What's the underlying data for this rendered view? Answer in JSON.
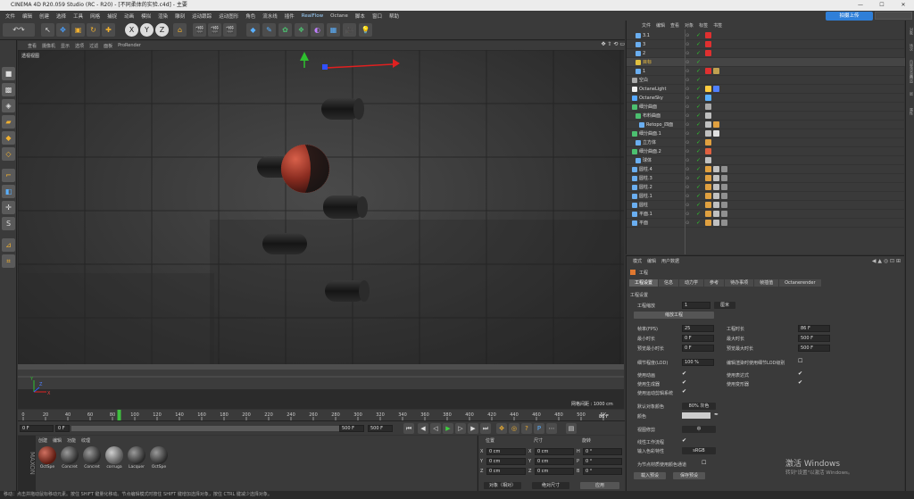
{
  "window": {
    "title": "CINEMA 4D R20.059 Studio (RC - R20) - [不同柔体的实验.c4d] - 主要",
    "controls": [
      "—",
      "☐",
      "✕"
    ]
  },
  "menu": [
    "文件",
    "编辑",
    "创建",
    "选择",
    "工具",
    "网格",
    "捕捉",
    "动画",
    "模拟",
    "渲染",
    "雕刻",
    "运动跟踪",
    "运动图形",
    "角色",
    "流水线",
    "插件",
    "RealFlow",
    "Octane",
    "脚本",
    "窗口",
    "帮助"
  ],
  "upload": {
    "label": "拍摄上传"
  },
  "viewport": {
    "tabs": [
      "查看",
      "摄像机",
      "显示",
      "选项",
      "过滤",
      "面板",
      "ProRender"
    ],
    "label": "透视视图",
    "status": "网格间距 : 1000 cm",
    "axis": {
      "y": "Y",
      "z": "Z",
      "x": "X"
    }
  },
  "timeline": {
    "ticks": [
      "0",
      "20",
      "40",
      "60",
      "80",
      "100",
      "120",
      "140",
      "160",
      "180",
      "200",
      "220",
      "240",
      "260",
      "280",
      "300",
      "320",
      "340",
      "360",
      "380",
      "400",
      "420",
      "440",
      "460",
      "480",
      "500",
      "5K"
    ],
    "current": "86 F"
  },
  "transport": {
    "start": "0 F",
    "field2": "0 F",
    "end_a": "500 F",
    "end_b": "500 F"
  },
  "materials": {
    "menu": [
      "创建",
      "编辑",
      "功能",
      "纹理"
    ],
    "items": [
      "OctSpe",
      "Concret",
      "Concret",
      "corruga",
      "Lacquer",
      "OctSpe"
    ]
  },
  "coords": {
    "headers": [
      "位置",
      "尺寸",
      "旋转"
    ],
    "rows": [
      {
        "axis": "X",
        "pos": "0 cm",
        "sizeaxis": "X",
        "size": "0 cm",
        "rotaxis": "H",
        "rot": "0 °"
      },
      {
        "axis": "Y",
        "pos": "0 cm",
        "sizeaxis": "Y",
        "size": "0 cm",
        "rotaxis": "P",
        "rot": "0 °"
      },
      {
        "axis": "Z",
        "pos": "0 cm",
        "sizeaxis": "Z",
        "size": "0 cm",
        "rotaxis": "B",
        "rot": "0 °"
      }
    ],
    "mode": "对象（相对）",
    "sizemode": "绝对尺寸",
    "apply": "应用"
  },
  "objects": {
    "menu": [
      "文件",
      "编辑",
      "查看",
      "对象",
      "标签",
      "书签"
    ],
    "rows": [
      {
        "name": "3.1",
        "indent": 2,
        "color": "#6aaef0"
      },
      {
        "name": "3",
        "indent": 2,
        "color": "#6aaef0"
      },
      {
        "name": "2",
        "indent": 2,
        "color": "#6aaef0"
      },
      {
        "name": "目标",
        "indent": 2,
        "color": "#e0c040"
      },
      {
        "name": "1",
        "indent": 2,
        "color": "#6aaef0"
      },
      {
        "name": "空白",
        "indent": 1,
        "color": "#aaaaaa"
      },
      {
        "name": "OctaneLight",
        "indent": 1,
        "color": "#f0f0f0"
      },
      {
        "name": "OctaneSky",
        "indent": 1,
        "color": "#56a8ff"
      },
      {
        "name": "细分曲面",
        "indent": 1,
        "color": "#4cc070"
      },
      {
        "name": "布料曲面",
        "indent": 2,
        "color": "#4cc070"
      },
      {
        "name": "Retopo_四面",
        "indent": 3,
        "color": "#6aaef0"
      },
      {
        "name": "细分曲面.1",
        "indent": 1,
        "color": "#4cc070"
      },
      {
        "name": "立方体",
        "indent": 2,
        "color": "#6aaef0"
      },
      {
        "name": "细分曲面.2",
        "indent": 1,
        "color": "#4cc070"
      },
      {
        "name": "球体",
        "indent": 2,
        "color": "#6aaef0"
      },
      {
        "name": "圆柱.4",
        "indent": 1,
        "color": "#6aaef0"
      },
      {
        "name": "圆柱.3",
        "indent": 1,
        "color": "#6aaef0"
      },
      {
        "name": "圆柱.2",
        "indent": 1,
        "color": "#6aaef0"
      },
      {
        "name": "圆柱.1",
        "indent": 1,
        "color": "#6aaef0"
      },
      {
        "name": "圆柱",
        "indent": 1,
        "color": "#6aaef0"
      },
      {
        "name": "平面.1",
        "indent": 1,
        "color": "#6aaef0"
      },
      {
        "name": "平面",
        "indent": 1,
        "color": "#6aaef0"
      }
    ]
  },
  "attributes": {
    "menu": [
      "模式",
      "编辑",
      "用户数据"
    ],
    "title": "工程",
    "tabs": [
      "工程设置",
      "信息",
      "动力学",
      "参考",
      "待办事项",
      "帧插值",
      "Octanerender"
    ],
    "section": "工程设置",
    "scale_label": "工程缩放",
    "scale_value": "1",
    "scale_unit": "厘米",
    "scale_button": "缩放工程",
    "fps_label": "帧率(FPS)",
    "fps_value": "25",
    "projtime_label": "工程时长",
    "projtime_value": "86 F",
    "mintime_label": "最小时长",
    "mintime_value": "0 F",
    "maxtime_label": "最大时长",
    "maxtime_value": "500 F",
    "prevmin_label": "预览最小时长",
    "prevmin_value": "0 F",
    "prevmax_label": "预览最大时长",
    "prevmax_value": "500 F",
    "lod_label": "细节程度(LOD)",
    "lod_value": "100 %",
    "lod_check": "编辑渲染时使用细节LOD级别",
    "anim_label": "使用动画",
    "expr_label": "使用表达式",
    "gen_label": "使用生成器",
    "deform_label": "使用变形器",
    "motion_label": "使用运动剪辑系统",
    "defcolor_label": "默认对象颜色",
    "defcolor_value": "80% 灰色",
    "color_label": "颜色",
    "viewclip_label": "视图修剪",
    "viewclip_value": "中",
    "linear_label": "线性工作流程",
    "colorprofile_label": "输入色彩特性",
    "colorprofile_value": "sRGB",
    "vertexcolor_label": "为节点材质使用颜色通道",
    "load_button": "载入预设",
    "save_button": "保存预设"
  },
  "rightstrip": [
    "对象",
    "场次",
    "内容浏览器",
    "构造",
    "层",
    "属性"
  ],
  "status": "移动：点击并拖动鼠标移动元素。按住 SHIFT 键量化移动。节点编辑模式时按住 SHIFT 键增加选择对象，按住 CTRL 键减少选择对象。",
  "watermark": {
    "line1": "激活 Windows",
    "line2": "转到\"设置\"以激活 Windows。"
  }
}
